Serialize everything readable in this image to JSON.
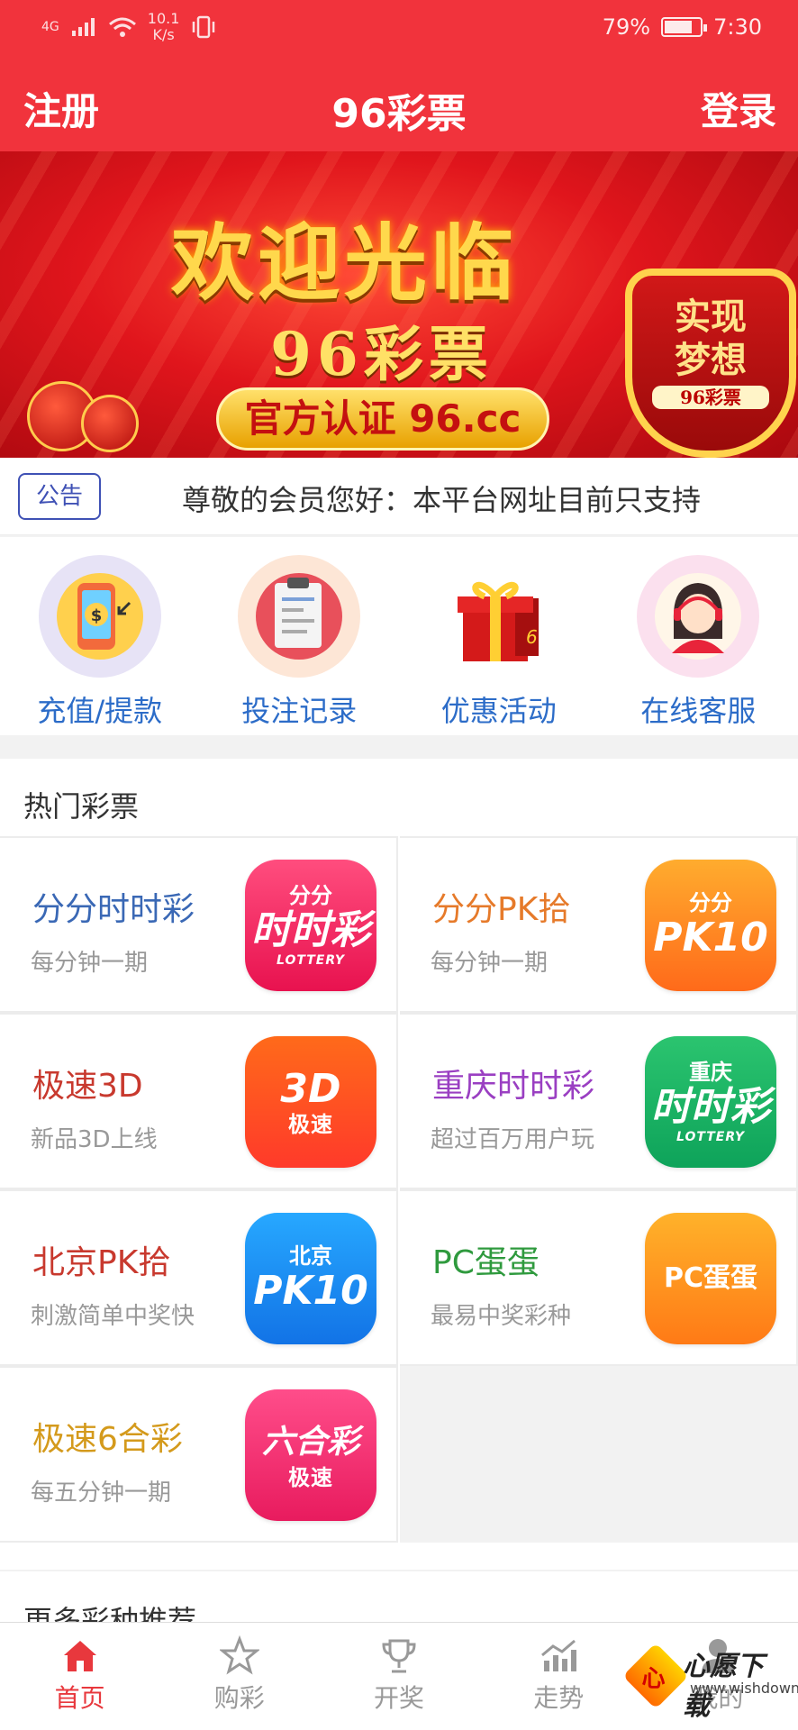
{
  "status": {
    "network": "4G",
    "speed_value": "10.1",
    "speed_unit": "K/s",
    "battery": "79%",
    "time": "7:30",
    "battery_level": 0.79
  },
  "header": {
    "left_label": "注册",
    "title": "96彩票",
    "right_label": "登录"
  },
  "banner": {
    "headline": "欢迎光临",
    "subline": "96彩票",
    "pill": "官方认证 96.cc",
    "shield_line1": "实现",
    "shield_line2": "梦想",
    "shield_line3": "96彩票",
    "slide_count": 6,
    "active_slide": 6
  },
  "notice": {
    "tag": "公告",
    "text": "尊敬的会员您好：本平台网址目前只支持"
  },
  "quick": [
    {
      "label": "充值/提款",
      "icon": "wallet-phone-icon"
    },
    {
      "label": "投注记录",
      "icon": "clipboard-icon"
    },
    {
      "label": "优惠活动",
      "icon": "gift-icon"
    },
    {
      "label": "在线客服",
      "icon": "customer-service-icon"
    }
  ],
  "hot": {
    "title": "热门彩票",
    "items": [
      {
        "name": "分分时时彩",
        "desc": "每分钟一期",
        "color": "#3a68b5",
        "logo_top": "分分",
        "logo_main": "时时彩",
        "logo_sub": "LOTTERY",
        "bg": "linear-gradient(#ff4d7e,#e8124f)"
      },
      {
        "name": "分分PK拾",
        "desc": "每分钟一期",
        "color": "#e67a2a",
        "logo_top": "分分",
        "logo_main": "PK10",
        "logo_sub": "",
        "bg": "linear-gradient(#ffac2e,#ff6a1a)"
      },
      {
        "name": "极速3D",
        "desc": "新品3D上线",
        "color": "#c8392e",
        "logo_top": "",
        "logo_main": "3D",
        "logo_sub": "极速",
        "bg": "linear-gradient(#ff6a1a,#ff3a2a)"
      },
      {
        "name": "重庆时时彩",
        "desc": "超过百万用户玩",
        "color": "#9a3fc2",
        "logo_top": "重庆",
        "logo_main": "时时彩",
        "logo_sub": "LOTTERY",
        "bg": "linear-gradient(#2bc46f,#0ea35a)"
      },
      {
        "name": "北京PK拾",
        "desc": "刺激简单中奖快",
        "color": "#c8392e",
        "logo_top": "北京",
        "logo_main": "PK10",
        "logo_sub": "",
        "bg": "linear-gradient(#27a8ff,#1273e6)"
      },
      {
        "name": "PC蛋蛋",
        "desc": "最易中奖彩种",
        "color": "#2f9a3e",
        "logo_top": "",
        "logo_main": "PC蛋蛋",
        "logo_sub": "",
        "bg": "linear-gradient(#ffb22a,#ff7a16)"
      },
      {
        "name": "极速6合彩",
        "desc": "每五分钟一期",
        "color": "#d49a1c",
        "logo_top": "",
        "logo_main": "六合彩",
        "logo_sub": "极速",
        "bg": "linear-gradient(#ff4d8a,#e81b5e)"
      }
    ]
  },
  "more_title": "更多彩种推荐",
  "tabs": [
    {
      "label": "首页",
      "icon": "home-icon",
      "active": true
    },
    {
      "label": "购彩",
      "icon": "star-icon",
      "active": false
    },
    {
      "label": "开奖",
      "icon": "trophy-icon",
      "active": false
    },
    {
      "label": "走势",
      "icon": "trend-chart-icon",
      "active": false
    },
    {
      "label": "我的",
      "icon": "user-icon",
      "active": false
    }
  ],
  "watermark": {
    "title": "心愿下载",
    "url": "www.wishdown.com",
    "glyph": "心"
  },
  "colors": {
    "brand_red": "#f1333c",
    "link_blue": "#2c6cc8",
    "tab_active": "#e8383d"
  }
}
